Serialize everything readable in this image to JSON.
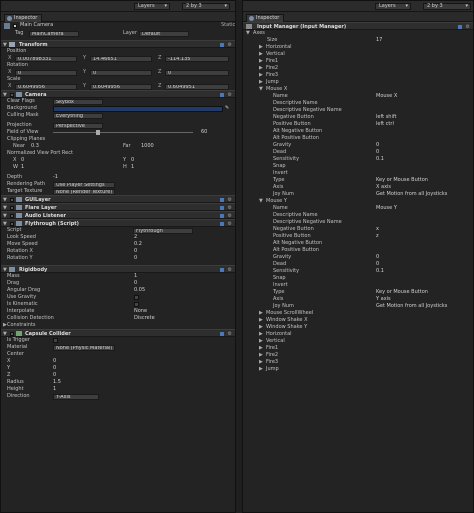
{
  "left": {
    "layers": "Layers",
    "layout": "2 by 3",
    "tab": "Inspector",
    "gameobject": {
      "name": "Main Camera",
      "tag_label": "Tag",
      "tag": "MainCamera",
      "layer_label": "Layer",
      "layer": "Default",
      "static": "Static"
    },
    "transform": {
      "title": "Transform",
      "position": "Position",
      "rotation": "Rotation",
      "scale": "Scale",
      "px": "0.007898331",
      "py": "14.46651",
      "pz": "-114.135",
      "rx": "0",
      "ry": "0",
      "rz": "0",
      "sx": "0.6049956",
      "sy": "0.6049956",
      "sz": "0.6049951"
    },
    "camera": {
      "title": "Camera",
      "clear_flags": "Clear Flags",
      "clear_flags_val": "Skybox",
      "background": "Background",
      "culling": "Culling Mask",
      "culling_val": "Everything",
      "projection": "Projection",
      "projection_val": "Perspective",
      "fov": "Field of View",
      "fov_val": "60",
      "clipping": "Clipping Planes",
      "near": "Near",
      "near_val": "0.3",
      "far": "Far",
      "far_val": "1000",
      "vprect": "Normalized View Port Rect",
      "x": "X",
      "x_val": "0",
      "y": "Y",
      "y_val": "0",
      "w": "W",
      "w_val": "1",
      "h": "H",
      "h_val": "1",
      "depth": "Depth",
      "depth_val": "-1",
      "rpath": "Rendering Path",
      "rpath_val": "Use Player Settings",
      "ttex": "Target Texture",
      "ttex_val": "None (Render Texture)"
    },
    "guilayer": "GUILayer",
    "flare": "Flare Layer",
    "audio": "Audio Listener",
    "flythrough": {
      "title": "Flythrough (Script)",
      "script": "Script",
      "script_val": "Flythrough",
      "look": "Look Speed",
      "look_val": "2",
      "move": "Move Speed",
      "move_val": "0.2",
      "rotx": "Rotation X",
      "rotx_val": "0",
      "roty": "Rotation Y",
      "roty_val": "0"
    },
    "rigidbody": {
      "title": "Rigidbody",
      "mass": "Mass",
      "mass_val": "1",
      "drag": "Drag",
      "drag_val": "0",
      "adrag": "Angular Drag",
      "adrag_val": "0.05",
      "grav": "Use Gravity",
      "kin": "Is Kinematic",
      "interp": "Interpolate",
      "interp_val": "None",
      "coll": "Collision Detection",
      "coll_val": "Discrete",
      "constraints": "Constraints"
    },
    "capsule": {
      "title": "Capsule Collider",
      "trigger": "Is Trigger",
      "material": "Material",
      "material_val": "None (Physic Material)",
      "center": "Center",
      "cx": "X",
      "cx_val": "0",
      "cy": "Y",
      "cy_val": "0",
      "cz": "Z",
      "cz_val": "0",
      "radius": "Radius",
      "radius_val": "1.5",
      "height": "Height",
      "height_val": "1",
      "direction": "Direction",
      "direction_val": "Y-Axis"
    }
  },
  "right": {
    "layers": "Layers",
    "layout": "2 by 3",
    "tab": "Inspector",
    "title": "Input Manager (Input Manager)",
    "axes": "Axes",
    "size_lbl": "Size",
    "size_val": "17",
    "collapsed_top": [
      "Horizontal",
      "Vertical",
      "Fire1",
      "Fire2",
      "Fire3",
      "Jump"
    ],
    "mouse_x": {
      "name": "Mouse X",
      "fields": [
        [
          "Name",
          "Mouse X"
        ],
        [
          "Descriptive Name",
          ""
        ],
        [
          "Descriptive Negative Name",
          ""
        ],
        [
          "Negative Button",
          "left shift"
        ],
        [
          "Positive Button",
          "left ctrl"
        ],
        [
          "Alt Negative Button",
          ""
        ],
        [
          "Alt Positive Button",
          ""
        ],
        [
          "Gravity",
          "0"
        ],
        [
          "Dead",
          "0"
        ],
        [
          "Sensitivity",
          "0.1"
        ],
        [
          "Snap",
          ""
        ],
        [
          "Invert",
          ""
        ],
        [
          "Type",
          "Key or Mouse Button"
        ],
        [
          "Axis",
          "X axis"
        ],
        [
          "Joy Num",
          "Get Motion from all Joysticks"
        ]
      ]
    },
    "mouse_y": {
      "name": "Mouse Y",
      "fields": [
        [
          "Name",
          "Mouse Y"
        ],
        [
          "Descriptive Name",
          ""
        ],
        [
          "Descriptive Negative Name",
          ""
        ],
        [
          "Negative Button",
          "x"
        ],
        [
          "Positive Button",
          "z"
        ],
        [
          "Alt Negative Button",
          ""
        ],
        [
          "Alt Positive Button",
          ""
        ],
        [
          "Gravity",
          "0"
        ],
        [
          "Dead",
          "0"
        ],
        [
          "Sensitivity",
          "0.1"
        ],
        [
          "Snap",
          ""
        ],
        [
          "Invert",
          ""
        ],
        [
          "Type",
          "Key or Mouse Button"
        ],
        [
          "Axis",
          "Y axis"
        ],
        [
          "Joy Num",
          "Get Motion from all Joysticks"
        ]
      ]
    },
    "collapsed_bottom": [
      "Mouse ScrollWheel",
      "Window Shake X",
      "Window Shake Y",
      "Horizontal",
      "Vertical",
      "Fire1",
      "Fire2",
      "Fire3",
      "Jump"
    ]
  }
}
